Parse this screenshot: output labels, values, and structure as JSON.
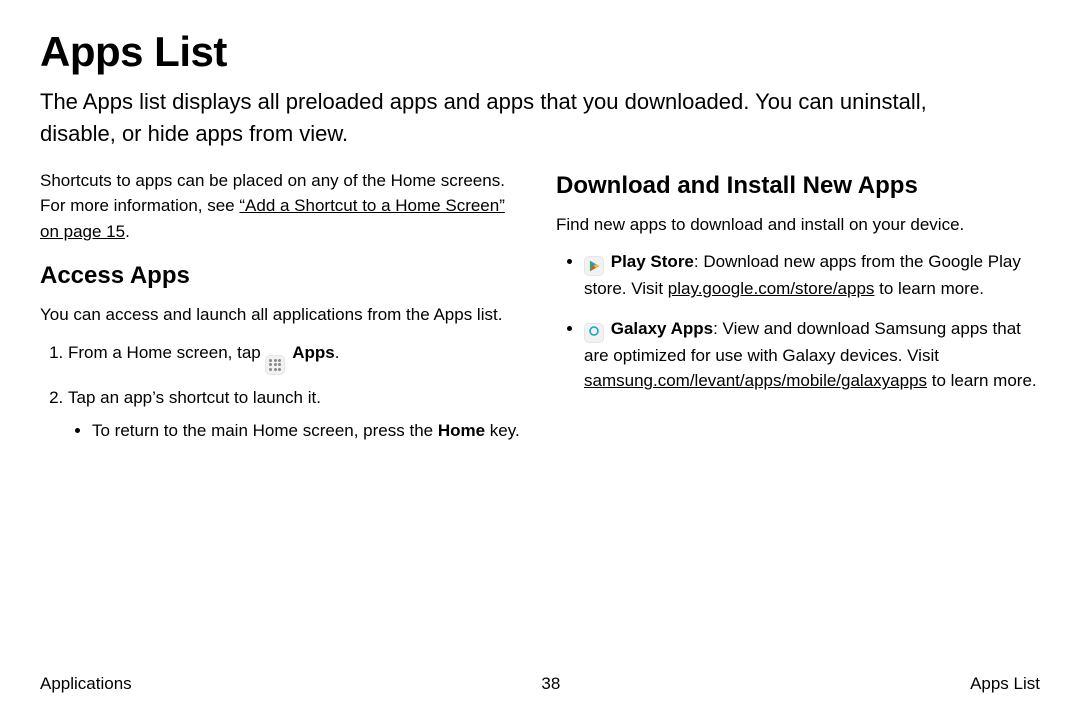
{
  "title": "Apps List",
  "intro": "The Apps list displays all preloaded apps and apps that you downloaded. You can uninstall, disable, or hide apps from view.",
  "left": {
    "shortcuts_prefix": "Shortcuts to apps can be placed on any of the Home screens. For more information, see ",
    "shortcuts_link": "“Add a Shortcut to a Home Screen” on page 15",
    "shortcuts_suffix": ".",
    "access_heading": "Access Apps",
    "access_desc": "You can access and launch all applications from the Apps list.",
    "step1_prefix": "From a Home screen, tap ",
    "step1_label": "Apps",
    "step1_suffix": ".",
    "step2": "Tap an app’s shortcut to launch it.",
    "step2_sub_prefix": "To return to the main Home screen, press the ",
    "step2_sub_bold": "Home",
    "step2_sub_suffix": " key."
  },
  "right": {
    "download_heading": "Download and Install New Apps",
    "download_desc": "Find new apps to download and install on your device.",
    "play_label": "Play Store",
    "play_text_a": ": Download new apps from the Google Play store. Visit ",
    "play_link": "play.google.com/store/apps",
    "play_text_b": " to learn more.",
    "galaxy_label": "Galaxy Apps",
    "galaxy_text_a": ": View and download Samsung apps that are optimized for use with Galaxy devices. Visit ",
    "galaxy_link": "samsung.com/levant/apps/mobile/galaxyapps",
    "galaxy_text_b": " to learn more."
  },
  "footer": {
    "left": "Applications",
    "center": "38",
    "right": "Apps List"
  }
}
